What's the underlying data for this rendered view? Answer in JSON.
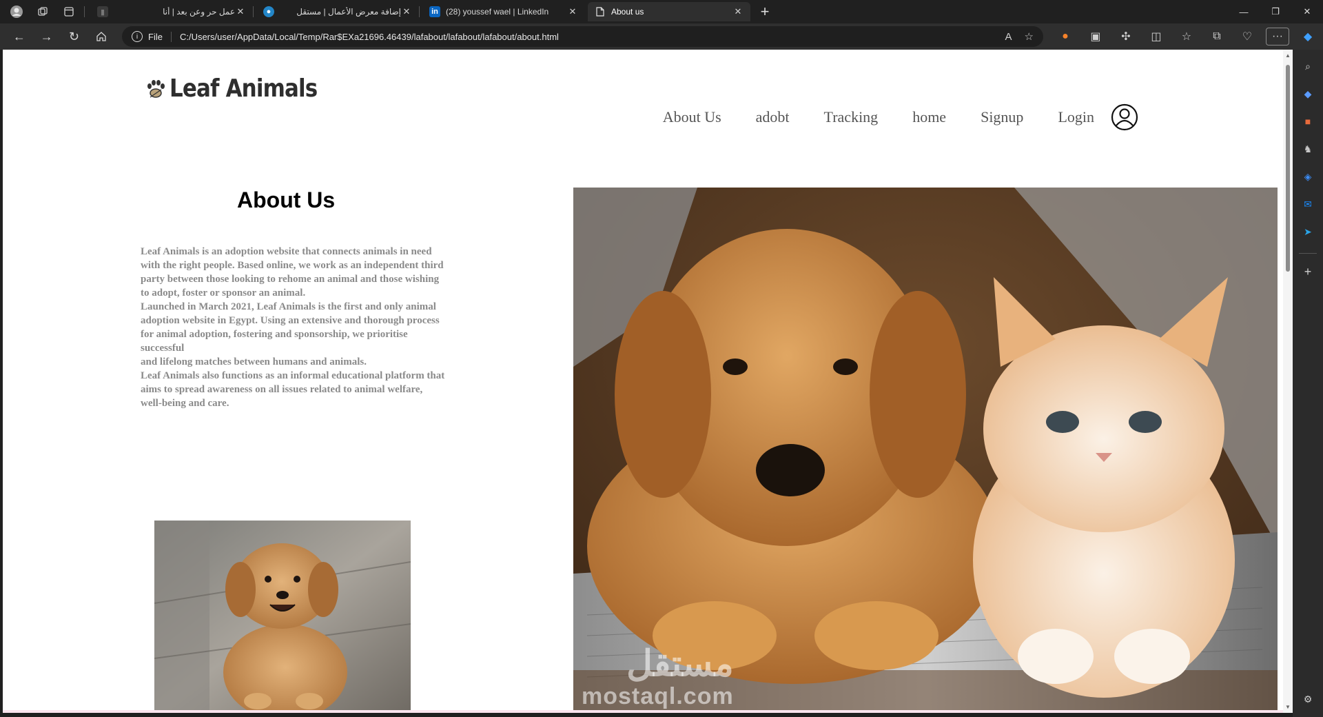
{
  "browser": {
    "tabs": [
      {
        "title": "عمل حر وعن بعد | أنا",
        "favicon": "tab-favicon-generic"
      },
      {
        "title": "إضافة معرض الأعمال | مستقل",
        "favicon": "mostaql-favicon"
      },
      {
        "title": "(28) youssef wael | LinkedIn",
        "favicon": "linkedin-favicon"
      },
      {
        "title": "About us",
        "favicon": "document-icon",
        "active": true
      }
    ],
    "address": {
      "scheme_label": "File",
      "url": "C:/Users/user/AppData/Local/Temp/Rar$EXa21696.46439/lafabout/lafabout/lafabout/about.html"
    }
  },
  "site": {
    "logo_text": "Leaf Animals",
    "nav": [
      "About Us",
      "adobt",
      "Tracking",
      "home",
      "Signup",
      "Login"
    ],
    "about_title": "About Us",
    "about_lines": [
      "Leaf Animals is an adoption website that connects animals in need",
      "with the right people. Based online, we work as an independent third",
      "party between those looking to rehome an animal and those wishing",
      "to adopt, foster or sponsor an animal.",
      "Launched in March 2021, Leaf Animals is the first and only animal",
      "adoption website in Egypt. Using an extensive and thorough process",
      "for animal adoption, fostering and sponsorship, we prioritise successful",
      "and lifelong matches between humans and animals.",
      "Leaf Animals also functions as an informal educational platform that",
      "aims to spread awareness on all issues related to animal welfare,",
      "well-being and care."
    ],
    "watermark_ar": "مستقل",
    "watermark_en": "mostaql.com"
  },
  "colors": {
    "nav_text": "#555555",
    "body_text": "#8a8a8a",
    "chrome_dark": "#202020",
    "toolbar": "#2f2f2f"
  }
}
